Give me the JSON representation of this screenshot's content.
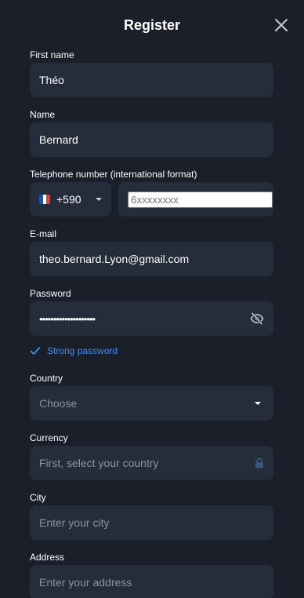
{
  "modal": {
    "title": "Register"
  },
  "form": {
    "first_name": {
      "label": "First name",
      "value": "Théo"
    },
    "name": {
      "label": "Name",
      "value": "Bernard"
    },
    "telephone": {
      "label": "Telephone number (international format)",
      "country_code": "+590",
      "placeholder": "6xxxxxxxx",
      "flag_colors": [
        "#1f4fb8",
        "#ffffff",
        "#e33b3b"
      ]
    },
    "email": {
      "label": "E-mail",
      "value": "theo.bernard.Lyon@gmail.com"
    },
    "password": {
      "label": "Password",
      "masked_value": "••••••••••••••••••••",
      "strength_text": "Strong password"
    },
    "country": {
      "label": "Country",
      "placeholder": "Choose"
    },
    "currency": {
      "label": "Currency",
      "placeholder": "First, select your country"
    },
    "city": {
      "label": "City",
      "placeholder": "Enter your city"
    },
    "address": {
      "label": "Address",
      "placeholder": "Enter your address"
    }
  },
  "colors": {
    "modal_bg": "#1a1f29",
    "field_bg": "#252d3b",
    "accent": "#3d8ff0",
    "placeholder": "#8a93a3"
  },
  "icons": {
    "close": "close-icon",
    "dropdown": "chevron-down-icon",
    "visibility": "eye-off-icon",
    "lock": "lock-icon",
    "check": "check-icon"
  }
}
